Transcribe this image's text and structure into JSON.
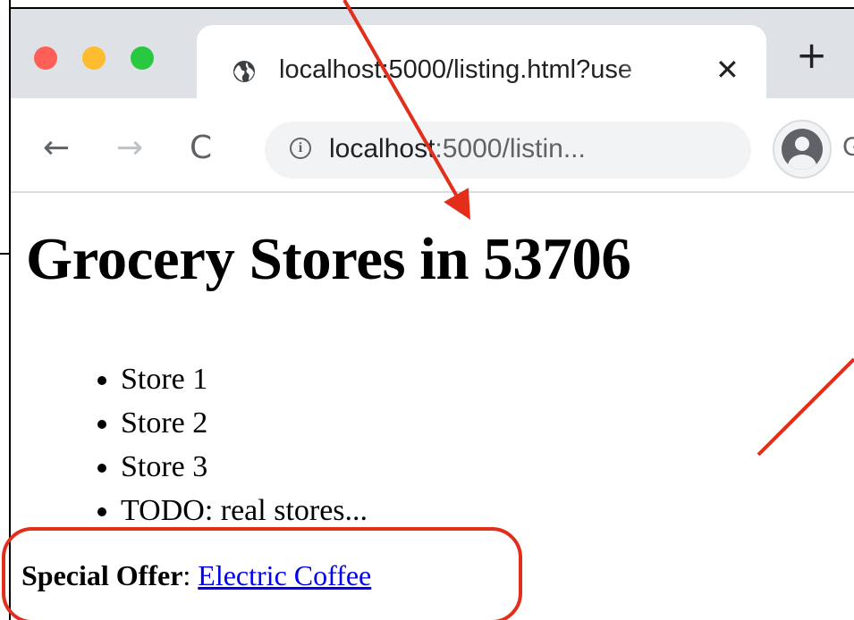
{
  "browser": {
    "tab": {
      "title": "localhost:5000/listing.html?use",
      "close_glyph": "✕",
      "favicon_icon": "globe-icon"
    },
    "new_tab_glyph": "+",
    "nav": {
      "back_glyph": "←",
      "forward_glyph": "→",
      "reload_glyph": "C"
    },
    "address_bar": {
      "info_glyph": "i",
      "url_host": "localhost",
      "url_rest": ":5000/listin..."
    },
    "profile_icon": "profile-icon",
    "profile_text": "G"
  },
  "page": {
    "title": "Grocery Stores in 53706",
    "stores": [
      "Store 1",
      "Store 2",
      "Store 3",
      "TODO: real stores..."
    ],
    "offer": {
      "label": "Special Offer",
      "separator": ": ",
      "link_text": "Electric Coffee"
    }
  },
  "annotations": {
    "accent_color": "#e22e1a"
  }
}
